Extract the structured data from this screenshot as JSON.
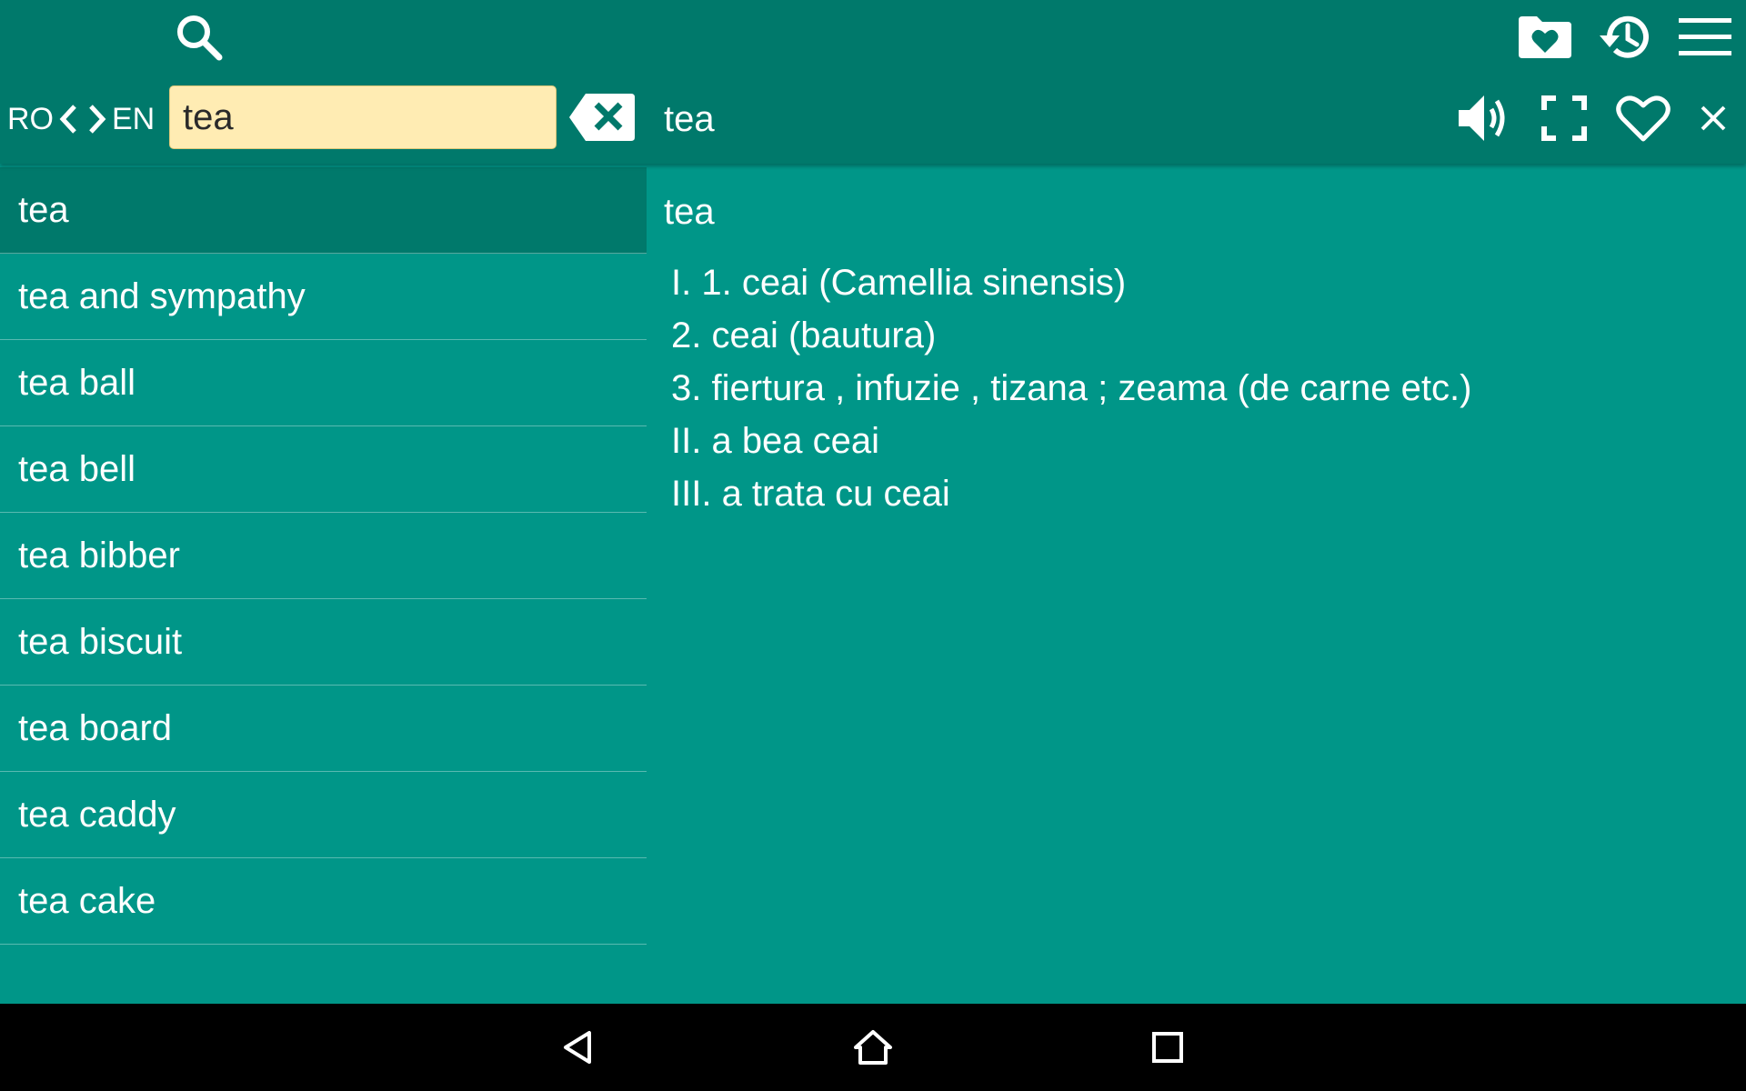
{
  "header": {
    "icons": {
      "search": "search-icon",
      "favorites_folder": "folder-heart-icon",
      "history": "history-icon",
      "menu": "hamburger-menu-icon"
    },
    "lang_from": "RO",
    "lang_to": "EN",
    "search_value": "tea",
    "entry_title": "tea",
    "entry_icons": {
      "speaker": "speaker-icon",
      "fullscreen": "fullscreen-icon",
      "favorite": "heart-outline-icon",
      "close": "close-icon",
      "clear": "backspace-clear-icon"
    }
  },
  "word_list": {
    "items": [
      {
        "label": "tea",
        "selected": true
      },
      {
        "label": "tea and sympathy",
        "selected": false
      },
      {
        "label": "tea ball",
        "selected": false
      },
      {
        "label": "tea bell",
        "selected": false
      },
      {
        "label": "tea bibber",
        "selected": false
      },
      {
        "label": "tea biscuit",
        "selected": false
      },
      {
        "label": "tea board",
        "selected": false
      },
      {
        "label": "tea caddy",
        "selected": false
      },
      {
        "label": "tea cake",
        "selected": false
      }
    ]
  },
  "definition": {
    "headword": "tea",
    "lines": [
      "I. 1. ceai (Camellia sinensis)",
      "2. ceai (bautura)",
      "3. fiertura , infuzie , tizana ; zeama (de carne etc.)",
      "II. a bea ceai",
      "III. a trata cu ceai"
    ]
  },
  "navbar": {
    "back": "nav-back-icon",
    "home": "nav-home-icon",
    "recent": "nav-recent-apps-icon"
  },
  "colors": {
    "toolbar": "#00796b",
    "content": "#009688",
    "search_field": "#ffecb3",
    "navbar": "#000000"
  }
}
